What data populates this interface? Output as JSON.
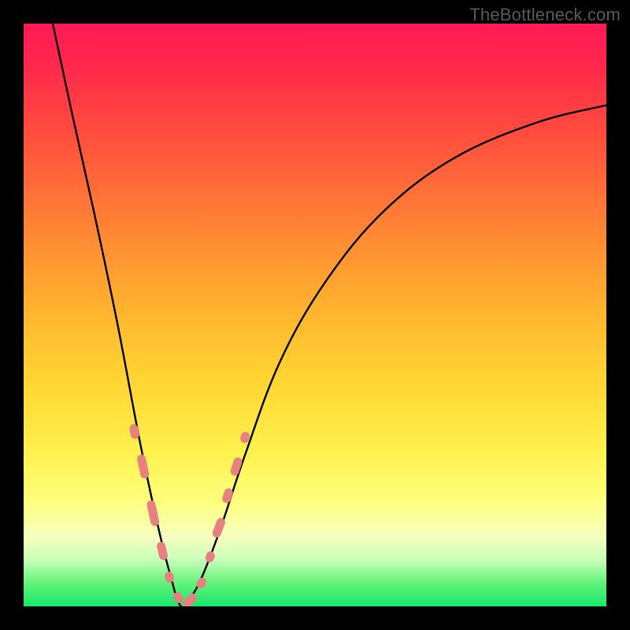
{
  "attribution": "TheBottleneck.com",
  "colors": {
    "frame": "#000000",
    "bead": "#e98080",
    "curve": "#000000",
    "gradient_top": "#ff1a55",
    "gradient_bottom": "#17e86b"
  },
  "chart_data": {
    "type": "line",
    "title": "",
    "xlabel": "",
    "ylabel": "",
    "xlim": [
      0,
      100
    ],
    "ylim": [
      0,
      100
    ],
    "note": "Axes are unlabeled; values are estimated as percentage of plot area (0–100 each axis). Curve shows a V-shaped dip reaching ~0 at x≈27 then rising asymptotically toward the right.",
    "series": [
      {
        "name": "curve",
        "x": [
          5,
          8,
          12,
          16,
          20,
          23,
          25,
          27,
          29,
          31,
          34,
          38,
          44,
          52,
          62,
          74,
          88,
          100
        ],
        "y": [
          100,
          86,
          68,
          49,
          28,
          14,
          6,
          0,
          2,
          6,
          14,
          26,
          42,
          56,
          68,
          77,
          83,
          86
        ]
      }
    ],
    "markers": {
      "name": "beads",
      "note": "Pink lozenge markers clustered near the valley on both arms of the V.",
      "points": [
        {
          "x": 19.0,
          "y": 30.0,
          "len": 4.0
        },
        {
          "x": 20.5,
          "y": 24.0,
          "len": 6.5
        },
        {
          "x": 22.2,
          "y": 16.0,
          "len": 7.0
        },
        {
          "x": 23.8,
          "y": 9.5,
          "len": 5.0
        },
        {
          "x": 25.0,
          "y": 5.0,
          "len": 3.0
        },
        {
          "x": 26.5,
          "y": 1.5,
          "len": 3.0
        },
        {
          "x": 28.5,
          "y": 1.0,
          "len": 4.5
        },
        {
          "x": 30.5,
          "y": 4.0,
          "len": 3.0
        },
        {
          "x": 32.0,
          "y": 8.5,
          "len": 3.0
        },
        {
          "x": 33.5,
          "y": 13.5,
          "len": 5.5
        },
        {
          "x": 35.0,
          "y": 19.0,
          "len": 4.0
        },
        {
          "x": 36.5,
          "y": 24.0,
          "len": 5.0
        },
        {
          "x": 38.0,
          "y": 29.0,
          "len": 3.0
        }
      ]
    }
  }
}
